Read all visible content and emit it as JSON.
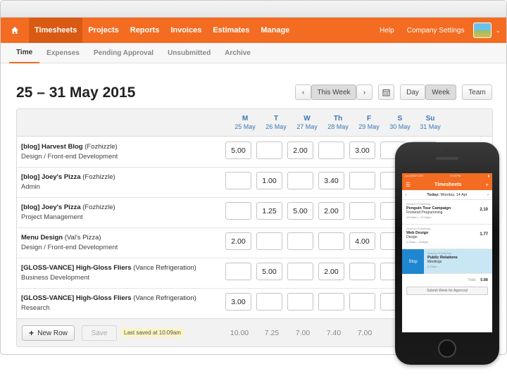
{
  "nav": {
    "items": [
      {
        "label": "Timesheets",
        "active": true
      },
      {
        "label": "Projects"
      },
      {
        "label": "Reports"
      },
      {
        "label": "Invoices"
      },
      {
        "label": "Estimates"
      },
      {
        "label": "Manage"
      }
    ],
    "help": "Help",
    "company_settings": "Company Settings"
  },
  "subnav": [
    "Time",
    "Expenses",
    "Pending Approval",
    "Unsubmitted",
    "Archive"
  ],
  "title": "25 – 31 May 2015",
  "controls": {
    "prev": "‹",
    "this_week": "This Week",
    "next": "›",
    "day": "Day",
    "week": "Week",
    "team": "Team"
  },
  "days": [
    {
      "d": "M",
      "date": "25 May"
    },
    {
      "d": "T",
      "date": "26 May"
    },
    {
      "d": "W",
      "date": "27 May"
    },
    {
      "d": "Th",
      "date": "28 May"
    },
    {
      "d": "F",
      "date": "29 May"
    },
    {
      "d": "S",
      "date": "30 May"
    },
    {
      "d": "Su",
      "date": "31 May"
    }
  ],
  "rows": [
    {
      "project": "[blog] Harvest Blog",
      "client": "(Fozhizzle)",
      "task": "Design / Front-end Development",
      "hours": [
        "5.00",
        "",
        "2.00",
        "",
        "3.00",
        "",
        ""
      ]
    },
    {
      "project": "[blog] Joey's Pizza",
      "client": "(Fozhizzle)",
      "task": "Admin",
      "hours": [
        "",
        "1.00",
        "",
        "3.40",
        "",
        "",
        ""
      ]
    },
    {
      "project": "[blog] Joey's Pizza",
      "client": "(Fozhizzle)",
      "task": "Project Management",
      "hours": [
        "",
        "1.25",
        "5.00",
        "2.00",
        "",
        "",
        ""
      ]
    },
    {
      "project": "Menu Design",
      "client": "(Val's Pizza)",
      "task": "Design / Front-end Development",
      "hours": [
        "2.00",
        "",
        "",
        "",
        "4.00",
        "",
        ""
      ]
    },
    {
      "project": "[GLOSS-VANCE] High-Gloss Fliers",
      "client": "(Vance Refrigeration)",
      "task": "Business Development",
      "hours": [
        "",
        "5.00",
        "",
        "2.00",
        "",
        "",
        ""
      ]
    },
    {
      "project": "[GLOSS-VANCE] High-Gloss Fliers",
      "client": "(Vance Refrigeration)",
      "task": "Research",
      "hours": [
        "3.00",
        "",
        "",
        "",
        "",
        "",
        ""
      ]
    }
  ],
  "footer": {
    "new_row": "New Row",
    "save": "Save",
    "last_saved": "Last saved at 10:09am",
    "totals": [
      "10.00",
      "7.25",
      "7.00",
      "7.40",
      "7.00"
    ]
  },
  "phone": {
    "carrier": "••••• AT&T  LTE",
    "time": "5:19 PM",
    "title": "Timesheets",
    "date_label": "Today:",
    "date_value": "Monday, 14 Apr",
    "entries": [
      {
        "client": "Astorian Publishing",
        "project": "Penguin Tour Campaign",
        "task": "Frontend Programming",
        "time": "10:04am – 12:10pm",
        "hours": "2.10"
      },
      {
        "client": "Astorian Publishing",
        "project": "Web Design",
        "task": "Design",
        "time": "1:20pm – 3:06pm",
        "hours": "1.77"
      }
    ],
    "running": {
      "stop": "Stop",
      "client": "Astorian Publishing",
      "project": "Public Relations",
      "task": "Meetings",
      "time": "3:19pm –"
    },
    "total_label": "Total:",
    "total_value": "5.88",
    "submit": "Submit Week for Approval"
  }
}
